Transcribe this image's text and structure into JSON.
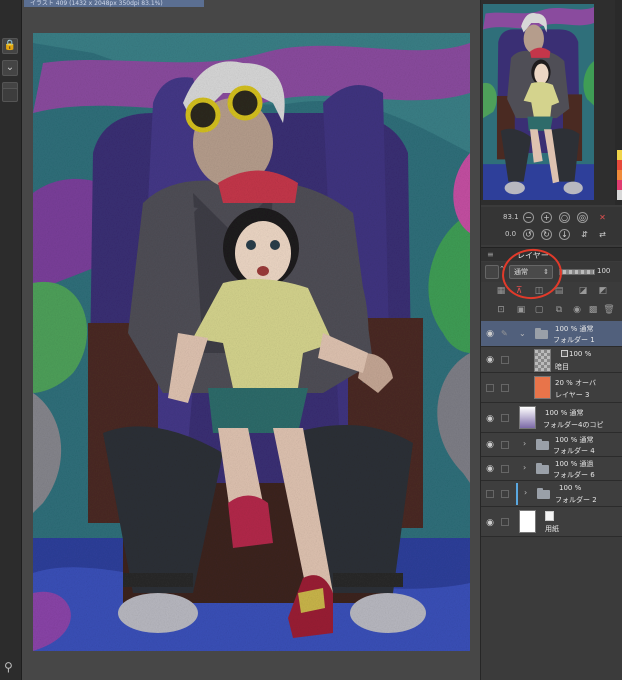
{
  "window": {
    "title_tab": "イラスト 409 (1432 x 2048px 350dpi 83.1%)"
  },
  "left_strip": {
    "buttons": [
      "🔒",
      "⌄",
      "⌄",
      "⌄"
    ]
  },
  "navigator": {
    "zoom": "83.1",
    "rotation": "0.0"
  },
  "layer_panel": {
    "title": "レイヤー",
    "blend_mode": "通常",
    "opacity": "100"
  },
  "layers": [
    {
      "pct": "100 % 通常",
      "name": "フォルダー 1",
      "kind": "folder",
      "selected": true
    },
    {
      "pct": "100 %",
      "name": "暗目",
      "kind": "layer"
    },
    {
      "pct": "20 % オーバ",
      "name": "レイヤー 3",
      "kind": "layer-orange"
    },
    {
      "pct": "100 % 通常",
      "name": "フォルダー4のコピ",
      "kind": "layer-image"
    },
    {
      "pct": "100 % 通常",
      "name": "フォルダー 4",
      "kind": "folder"
    },
    {
      "pct": "100 % 通過",
      "name": "フォルダー 6",
      "kind": "folder"
    },
    {
      "pct": "100 %",
      "name": "フォルダー 2",
      "kind": "folder"
    },
    {
      "pct": "",
      "name": "用紙",
      "kind": "paper"
    }
  ],
  "colors": {
    "accent_selection": "#51607c",
    "annotation_red": "#e23a2a",
    "orange_layer": "#e8744a"
  }
}
